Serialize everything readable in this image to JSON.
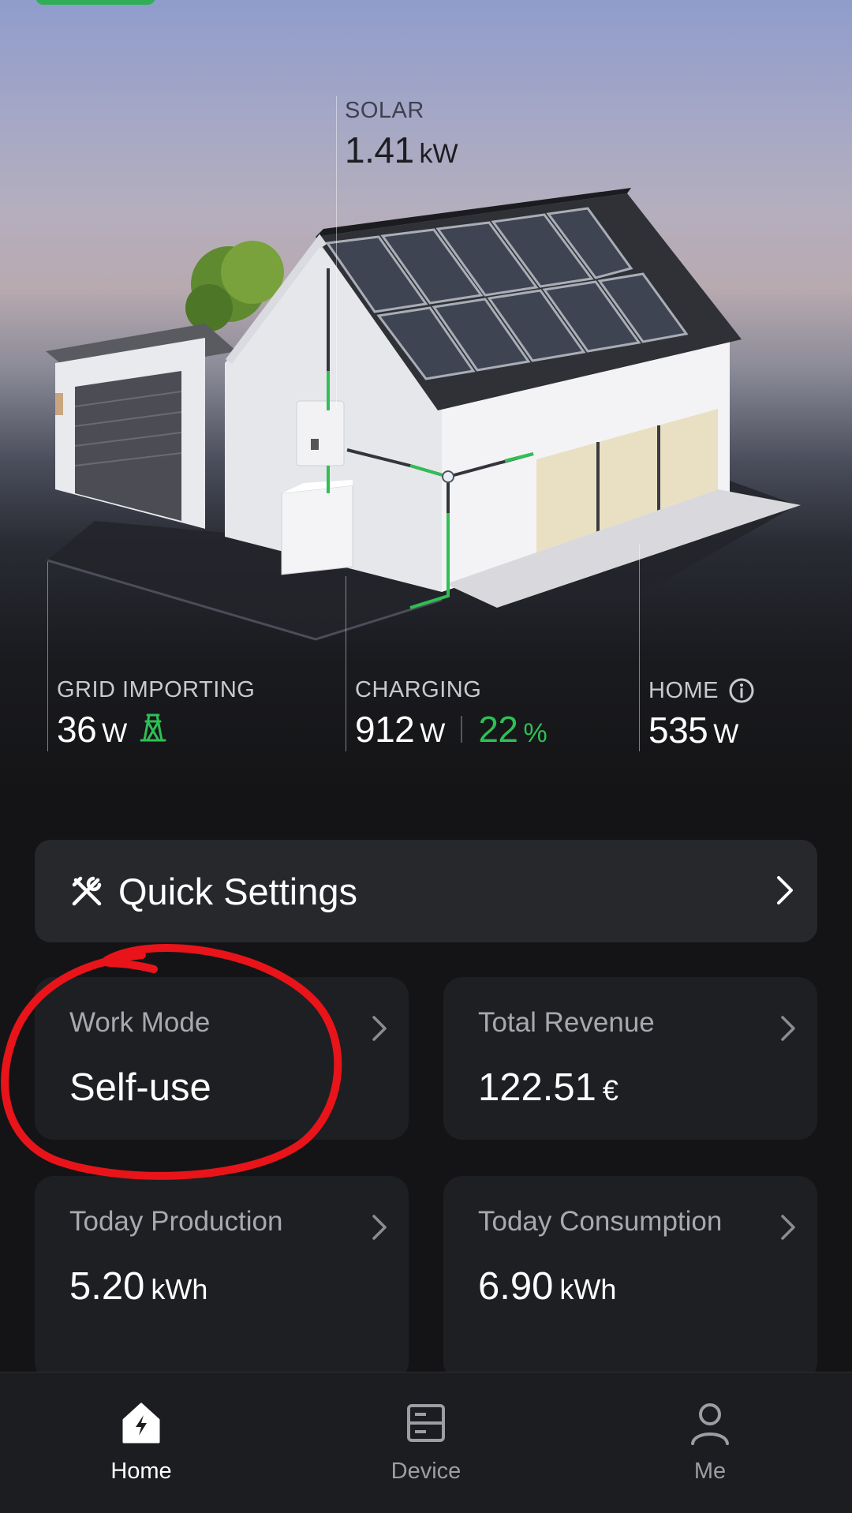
{
  "flow": {
    "solar": {
      "label": "SOLAR",
      "value": "1.41",
      "unit": "kW"
    },
    "grid": {
      "label": "GRID IMPORTING",
      "value": "36",
      "unit": "W",
      "icon": "grid-tower-icon"
    },
    "charging": {
      "label": "CHARGING",
      "value": "912",
      "unit": "W",
      "battery_percent": "22",
      "percent_unit": "%"
    },
    "home": {
      "label": "HOME",
      "value": "535",
      "unit": "W",
      "icon": "info-icon"
    }
  },
  "quick_settings": {
    "label": "Quick Settings",
    "icon": "tools-icon"
  },
  "cards": {
    "work_mode": {
      "label": "Work Mode",
      "value": "Self-use"
    },
    "total_revenue": {
      "label": "Total Revenue",
      "value": "122.51",
      "unit": "€"
    },
    "today_production": {
      "label": "Today Production",
      "value": "5.20",
      "unit": "kWh"
    },
    "today_consumption": {
      "label": "Today Consumption",
      "value": "6.90",
      "unit": "kWh"
    }
  },
  "nav": [
    {
      "label": "Home",
      "icon": "home-bolt-icon",
      "active": true
    },
    {
      "label": "Device",
      "icon": "device-icon",
      "active": false
    },
    {
      "label": "Me",
      "icon": "person-icon",
      "active": false
    }
  ],
  "colors": {
    "accent_green": "#2fbf55",
    "annotation_red": "#e8141a",
    "background": "#141416",
    "card": "#1e1f22"
  }
}
